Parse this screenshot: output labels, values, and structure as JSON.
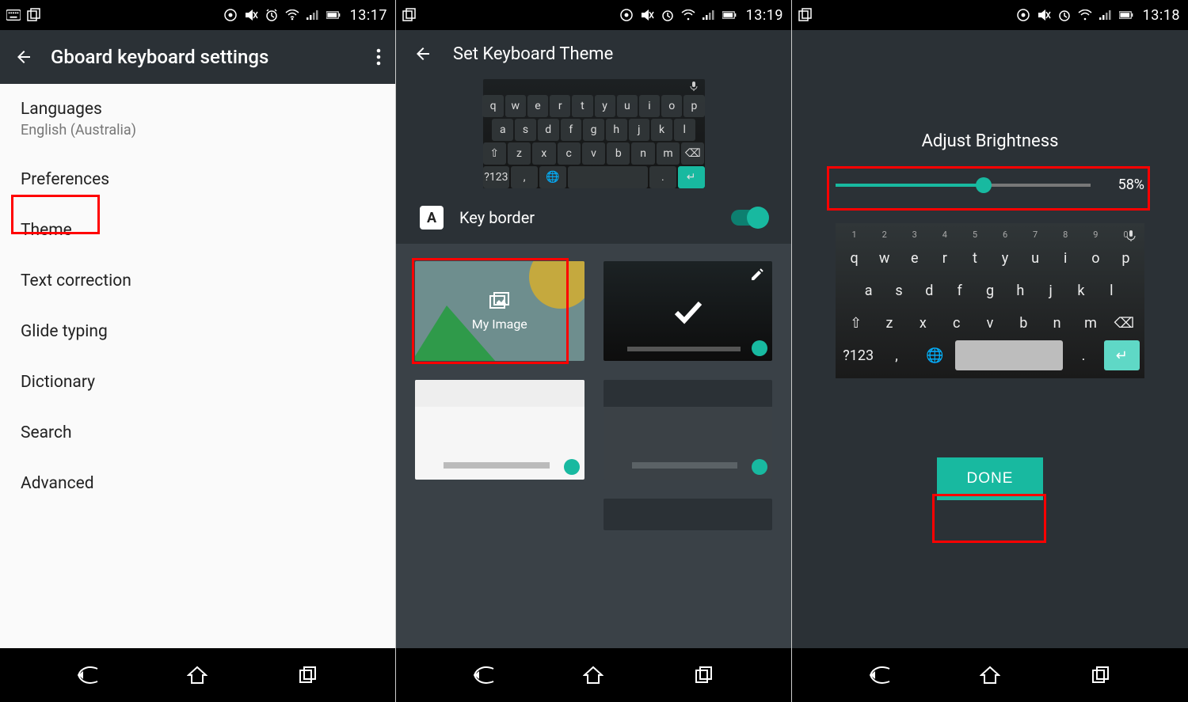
{
  "screen1": {
    "statusbar": {
      "time": "13:17"
    },
    "header": {
      "title": "Gboard keyboard settings"
    },
    "items": [
      {
        "title": "Languages",
        "sub": "English (Australia)"
      },
      {
        "title": "Preferences"
      },
      {
        "title": "Theme",
        "highlighted": true
      },
      {
        "title": "Text correction"
      },
      {
        "title": "Glide typing"
      },
      {
        "title": "Dictionary"
      },
      {
        "title": "Search"
      },
      {
        "title": "Advanced"
      }
    ]
  },
  "screen2": {
    "statusbar": {
      "time": "13:19"
    },
    "title": "Set Keyboard Theme",
    "key_border_label": "Key border",
    "key_border_on": true,
    "themes": {
      "my_image_label": "My Image"
    },
    "preview_keys": {
      "row1": [
        "q",
        "w",
        "e",
        "r",
        "t",
        "y",
        "u",
        "i",
        "o",
        "p"
      ],
      "row2": [
        "a",
        "s",
        "d",
        "f",
        "g",
        "h",
        "j",
        "k",
        "l"
      ],
      "row3": [
        "⇧",
        "z",
        "x",
        "c",
        "v",
        "b",
        "n",
        "m",
        "⌫"
      ],
      "row4": [
        "?123",
        ",",
        "🌐",
        " ",
        ".",
        "↵"
      ]
    }
  },
  "screen3": {
    "statusbar": {
      "time": "13:18"
    },
    "title": "Adjust Brightness",
    "brightness_pct": 58,
    "brightness_label": "58%",
    "done_label": "DONE",
    "preview_keys": {
      "nums": [
        "1",
        "2",
        "3",
        "4",
        "5",
        "6",
        "7",
        "8",
        "9",
        "0"
      ],
      "row1": [
        "q",
        "w",
        "e",
        "r",
        "t",
        "y",
        "u",
        "i",
        "o",
        "p"
      ],
      "row2": [
        "a",
        "s",
        "d",
        "f",
        "g",
        "h",
        "j",
        "k",
        "l"
      ],
      "row3": [
        "⇧",
        "z",
        "x",
        "c",
        "v",
        "b",
        "n",
        "m",
        "⌫"
      ],
      "row4": [
        "?123",
        ",",
        "🌐",
        " ",
        ".",
        "↵"
      ]
    }
  }
}
